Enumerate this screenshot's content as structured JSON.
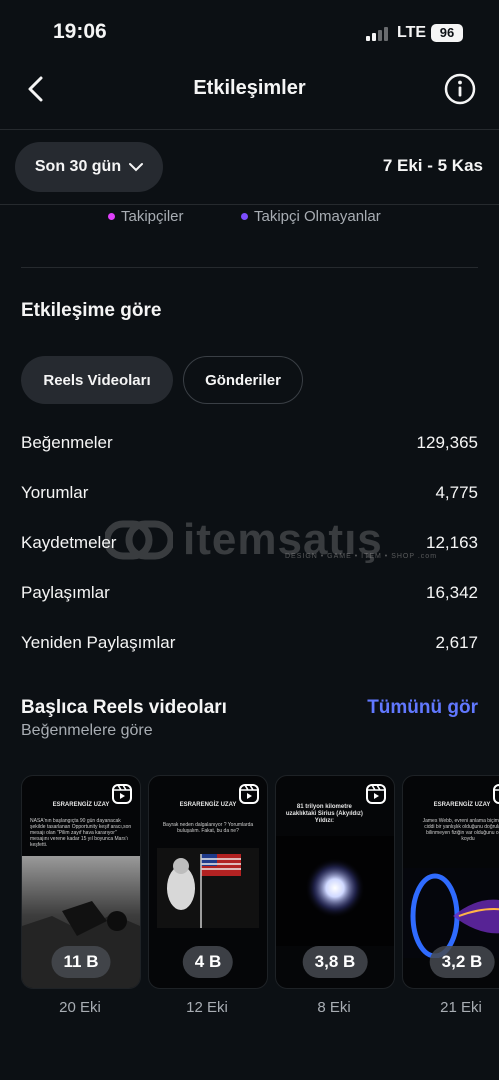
{
  "status_bar": {
    "time": "19:06",
    "network": "LTE",
    "battery": "96"
  },
  "header": {
    "title": "Etkileşimler",
    "back_icon": "chevron-left-icon",
    "info_icon": "info-icon"
  },
  "filter": {
    "range_label": "Son 30 gün",
    "date_range": "7 Eki - 5 Kas"
  },
  "legend": [
    {
      "label": "Takipçiler",
      "color": "#e040fb"
    },
    {
      "label": "Takipçi Olmayanlar",
      "color": "#7c4dff"
    }
  ],
  "by_interaction": {
    "title": "Etkileşime göre",
    "tabs": [
      {
        "label": "Reels Videoları",
        "active": true
      },
      {
        "label": "Gönderiler",
        "active": false
      }
    ],
    "metrics": [
      {
        "label": "Beğenmeler",
        "value": "129,365"
      },
      {
        "label": "Yorumlar",
        "value": "4,775"
      },
      {
        "label": "Kaydetmeler",
        "value": "12,163"
      },
      {
        "label": "Paylaşımlar",
        "value": "16,342"
      },
      {
        "label": "Yeniden Paylaşımlar",
        "value": "2,617"
      }
    ]
  },
  "watermark": {
    "text": "itemsatış",
    "sub": "DESIGN • GAME • ITEM • SHOP .com"
  },
  "top_reels": {
    "title": "Başlıca Reels videoları",
    "subtitle": "Beğenmelere göre",
    "see_all": "Tümünü gör",
    "reels": [
      {
        "title": "ESRARENGİZ UZAY",
        "caption": "NASA'nın başlangıçta 90 gün dayanacak şekilde tasarlanan Opportunity keşif aracı,son mesajı olan \"Pilim zayıf hava kararıyor\" mesajını verene kadar 15 yıl boyunca Mars'ı keşfetti.",
        "count": "11 B",
        "date": "20 Eki"
      },
      {
        "title": "ESRARENGİZ UZAY",
        "caption": "Bayrak neden dalgalanıyor ? Yorumlarda buluşalım. Fakat, bu da ne?",
        "count": "4 B",
        "date": "12 Eki"
      },
      {
        "title": "81 trilyon kilometre uzaklıktaki Sirius (Akyıldız) Yıldızı:",
        "caption": "",
        "count": "3,8 B",
        "date": "8 Eki"
      },
      {
        "title": "ESRARENGİZ UZAY",
        "caption": "James Webb, evreni anlama biçimimizde ciddi bir yanlışlık olduğunu doğruladı ve bilinmeyen fiziğin var olduğunu ortaya koydu",
        "count": "3,2 B",
        "date": "21 Eki"
      }
    ]
  }
}
